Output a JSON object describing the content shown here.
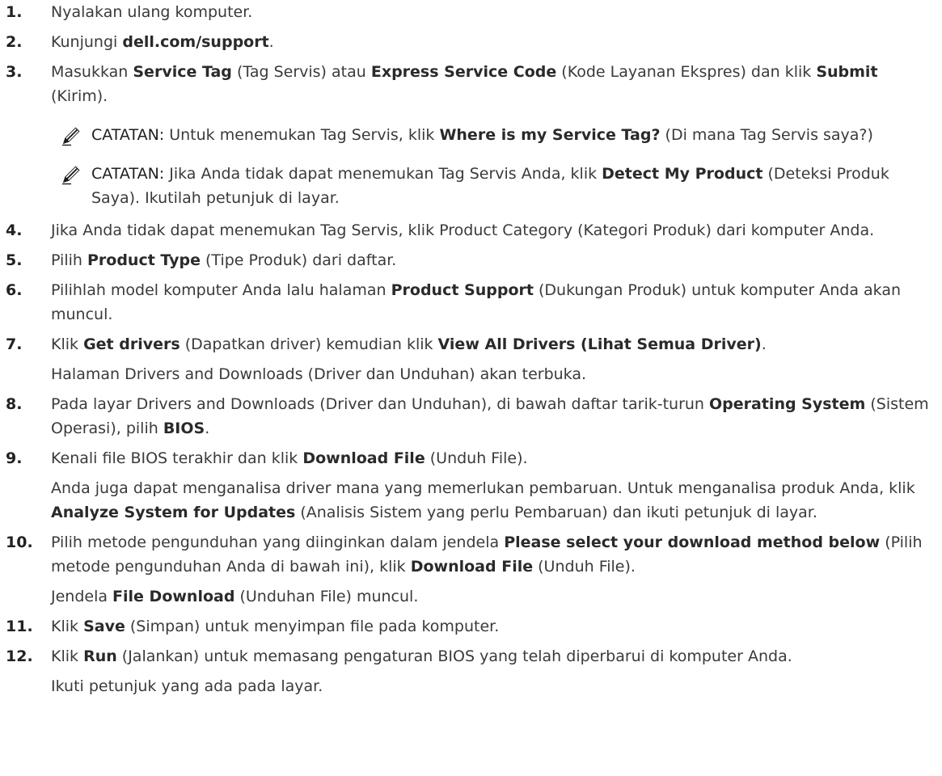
{
  "steps": [
    {
      "num": "1.",
      "parts": [
        {
          "t": "Nyalakan ulang komputer."
        }
      ]
    },
    {
      "num": "2.",
      "parts": [
        {
          "t": "Kunjungi "
        },
        {
          "t": "dell.com/support",
          "b": true
        },
        {
          "t": "."
        }
      ]
    },
    {
      "num": "3.",
      "parts": [
        {
          "t": "Masukkan "
        },
        {
          "t": "Service Tag",
          "b": true
        },
        {
          "t": " (Tag Servis) atau "
        },
        {
          "t": "Express Service Code",
          "b": true
        },
        {
          "t": " (Kode Layanan Ekspres) dan klik "
        },
        {
          "t": "Submit",
          "b": true
        },
        {
          "t": " (Kirim)."
        }
      ],
      "notes": [
        {
          "label": "CATATAN:",
          "parts": [
            {
              "t": " Untuk menemukan Tag Servis, klik "
            },
            {
              "t": "Where is my Service Tag?",
              "b": true
            },
            {
              "t": " (Di mana Tag Servis saya?)"
            }
          ]
        },
        {
          "label": "CATATAN:",
          "parts": [
            {
              "t": " Jika Anda tidak dapat menemukan Tag Servis Anda, klik "
            },
            {
              "t": "Detect My Product",
              "b": true
            },
            {
              "t": " (Deteksi Produk Saya). Ikutilah petunjuk di layar."
            }
          ]
        }
      ]
    },
    {
      "num": "4.",
      "parts": [
        {
          "t": "Jika Anda tidak dapat menemukan Tag Servis, klik Product Category (Kategori Produk) dari komputer Anda."
        }
      ]
    },
    {
      "num": "5.",
      "parts": [
        {
          "t": "Pilih "
        },
        {
          "t": "Product Type",
          "b": true
        },
        {
          "t": " (Tipe Produk) dari daftar."
        }
      ]
    },
    {
      "num": "6.",
      "parts": [
        {
          "t": "Pilihlah model komputer Anda lalu halaman "
        },
        {
          "t": "Product Support",
          "b": true
        },
        {
          "t": " (Dukungan Produk) untuk komputer Anda akan muncul."
        }
      ]
    },
    {
      "num": "7.",
      "parts": [
        {
          "t": "Klik "
        },
        {
          "t": "Get drivers",
          "b": true
        },
        {
          "t": " (Dapatkan driver) kemudian klik "
        },
        {
          "t": "View All Drivers (Lihat Semua Driver)",
          "b": true
        },
        {
          "t": "."
        }
      ],
      "sub": [
        [
          {
            "t": "Halaman Drivers and Downloads (Driver dan Unduhan) akan terbuka."
          }
        ]
      ]
    },
    {
      "num": "8.",
      "parts": [
        {
          "t": "Pada layar Drivers and Downloads (Driver dan Unduhan), di bawah daftar tarik-turun "
        },
        {
          "t": "Operating System",
          "b": true
        },
        {
          "t": " (Sistem Operasi), pilih "
        },
        {
          "t": "BIOS",
          "b": true
        },
        {
          "t": "."
        }
      ]
    },
    {
      "num": "9.",
      "parts": [
        {
          "t": "Kenali file BIOS terakhir dan klik "
        },
        {
          "t": "Download File",
          "b": true
        },
        {
          "t": " (Unduh File)."
        }
      ],
      "sub": [
        [
          {
            "t": "Anda juga dapat menganalisa driver mana yang memerlukan pembaruan. Untuk menganalisa produk Anda, klik "
          },
          {
            "t": "Analyze System for Updates",
            "b": true
          },
          {
            "t": " (Analisis Sistem yang perlu Pembaruan) dan ikuti petunjuk di layar."
          }
        ]
      ]
    },
    {
      "num": "10.",
      "parts": [
        {
          "t": "Pilih metode pengunduhan yang diinginkan dalam jendela "
        },
        {
          "t": "Please select your download method below",
          "b": true
        },
        {
          "t": " (Pilih metode pengunduhan Anda di bawah ini), klik "
        },
        {
          "t": "Download File",
          "b": true
        },
        {
          "t": " (Unduh File)."
        }
      ],
      "sub": [
        [
          {
            "t": "Jendela "
          },
          {
            "t": "File Download",
            "b": true
          },
          {
            "t": " (Unduhan File) muncul."
          }
        ]
      ]
    },
    {
      "num": "11.",
      "parts": [
        {
          "t": "Klik "
        },
        {
          "t": "Save",
          "b": true
        },
        {
          "t": " (Simpan) untuk menyimpan file pada komputer."
        }
      ]
    },
    {
      "num": "12.",
      "parts": [
        {
          "t": "Klik "
        },
        {
          "t": "Run",
          "b": true
        },
        {
          "t": " (Jalankan) untuk memasang pengaturan BIOS yang telah diperbarui di komputer Anda."
        }
      ],
      "sub": [
        [
          {
            "t": "Ikuti petunjuk yang ada pada layar."
          }
        ]
      ]
    }
  ],
  "icons": {
    "note": "pencil-note-icon"
  }
}
